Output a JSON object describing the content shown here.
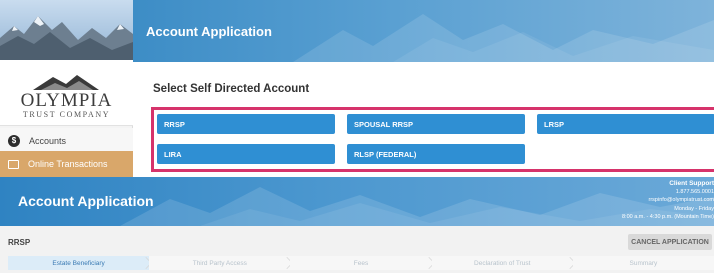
{
  "portal": {
    "header_title": "Account Application",
    "logo": {
      "name": "OLYMPIA",
      "subtitle": "TRUST COMPANY"
    },
    "sidebar": {
      "items": [
        {
          "label": "Accounts",
          "icon": "dollar-circle-icon"
        },
        {
          "label": "Online Transactions",
          "icon": "monitor-icon"
        }
      ]
    },
    "select_title": "Select Self Directed Account",
    "accounts": [
      "RRSP",
      "SPOUSAL RRSP",
      "LRSP",
      "LIRA",
      "RLSP (FEDERAL)"
    ],
    "highlight_color": "#d6336b",
    "button_color": "#2f8fd3"
  },
  "application": {
    "header_title": "Account Application",
    "support": {
      "title": "Client Support",
      "phone": "1.877.565.0001",
      "email": "rrspinfo@olympiatrust.com",
      "days": "Monday - Friday",
      "hours": "8:00 a.m. - 4:30 p.m. (Mountain Time)"
    },
    "account_type": "RRSP",
    "cancel_label": "CANCEL APPLICATION",
    "steps": [
      "Estate Beneficiary",
      "Third Party Access",
      "Fees",
      "Declaration of Trust",
      "Summary"
    ],
    "active_step": 0
  }
}
